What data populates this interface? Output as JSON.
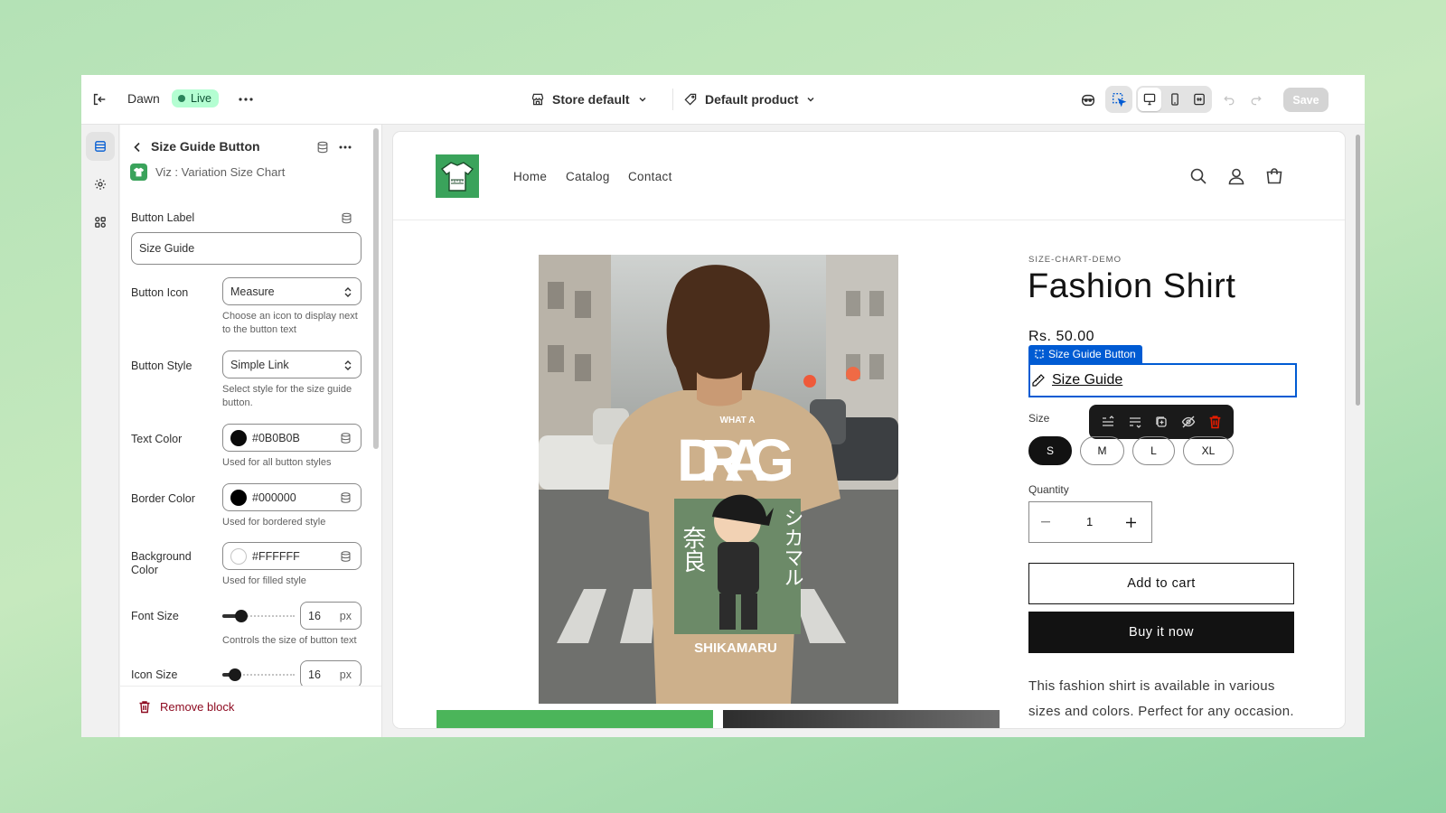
{
  "topbar": {
    "theme_name": "Dawn",
    "status": "Live",
    "store_selector": "Store default",
    "template_selector": "Default product",
    "save_label": "Save"
  },
  "panel": {
    "title": "Size Guide Button",
    "app_name": "Viz : Variation Size Chart",
    "button_label": {
      "label": "Button Label",
      "value": "Size Guide"
    },
    "button_icon": {
      "label": "Button Icon",
      "value": "Measure",
      "hint": "Choose an icon to display next to the button text"
    },
    "button_style": {
      "label": "Button Style",
      "value": "Simple Link",
      "hint": "Select style for the size guide button."
    },
    "text_color": {
      "label": "Text Color",
      "value": "#0B0B0B",
      "hint": "Used for all button styles",
      "swatch": "#0b0b0b"
    },
    "border_color": {
      "label": "Border Color",
      "value": "#000000",
      "hint": "Used for bordered style",
      "swatch": "#000000"
    },
    "background_color": {
      "label": "Background Color",
      "value": "#FFFFFF",
      "hint": "Used for filled style",
      "swatch": "#ffffff"
    },
    "font_size": {
      "label": "Font Size",
      "value": "16",
      "unit": "px",
      "hint": "Controls the size of button text"
    },
    "icon_size": {
      "label": "Icon Size",
      "value": "16",
      "unit": "px"
    },
    "remove_label": "Remove block"
  },
  "store": {
    "nav": [
      "Home",
      "Catalog",
      "Contact"
    ],
    "vendor": "SIZE-CHART-DEMO",
    "product_title": "Fashion Shirt",
    "price": "Rs. 50.00",
    "selection_tag": "Size Guide Button",
    "size_guide_link": "Size Guide",
    "size_label": "Size",
    "sizes": [
      "S",
      "M",
      "L",
      "XL"
    ],
    "quantity_label": "Quantity",
    "quantity": "1",
    "add_to_cart": "Add to cart",
    "buy_now": "Buy it now",
    "description": "This fashion shirt is available in various sizes and colors. Perfect for any occasion.",
    "shirt_print": {
      "top": "WHAT A",
      "main": "DRAG",
      "left_jp": "奈良",
      "right_jp": "シカマル",
      "bottom": "SHIKAMARU"
    }
  },
  "colors": {
    "accent": "#005bd3",
    "live_badge": "#b4fed2",
    "delete": "#e51c00",
    "remove_text": "#8e0b21",
    "logo_green": "#3aa35b"
  }
}
